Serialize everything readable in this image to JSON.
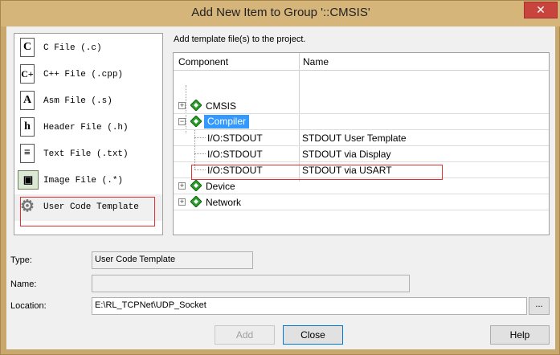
{
  "window": {
    "title": "Add New Item to Group '::CMSIS'",
    "close_glyph": "✕",
    "accent": "#d6b57a"
  },
  "file_types": [
    {
      "label": "C File (.c)",
      "icon": "c-file-icon",
      "glyph": "C"
    },
    {
      "label": "C++ File (.cpp)",
      "icon": "cpp-file-icon",
      "glyph": "C+"
    },
    {
      "label": "Asm File (.s)",
      "icon": "asm-file-icon",
      "glyph": "A"
    },
    {
      "label": "Header File (.h)",
      "icon": "header-file-icon",
      "glyph": "h"
    },
    {
      "label": "Text File (.txt)",
      "icon": "text-file-icon",
      "glyph": "≡"
    },
    {
      "label": "Image File (.*)",
      "icon": "image-file-icon",
      "glyph": "▣"
    },
    {
      "label": "User Code Template",
      "icon": "gear-icon",
      "glyph": "⚙"
    }
  ],
  "hint": "Add template file(s) to the project.",
  "tree": {
    "headers": {
      "component": "Component",
      "name": "Name"
    },
    "rows": [
      {
        "component": "CMSIS",
        "name": "",
        "expander": "+"
      },
      {
        "component": "Compiler",
        "name": "",
        "expander": "−"
      },
      {
        "component": "I/O:STDOUT",
        "name": "STDOUT User Template"
      },
      {
        "component": "I/O:STDOUT",
        "name": "STDOUT via Display"
      },
      {
        "component": "I/O:STDOUT",
        "name": "STDOUT via USART"
      },
      {
        "component": "Device",
        "name": "",
        "expander": "+"
      },
      {
        "component": "Network",
        "name": "",
        "expander": "+"
      }
    ]
  },
  "form": {
    "type_label": "Type:",
    "type_value": "User Code Template",
    "name_label": "Name:",
    "name_value": "",
    "location_label": "Location:",
    "location_value": "E:\\RL_TCPNet\\UDP_Socket",
    "browse_label": "..."
  },
  "buttons": {
    "add": "Add",
    "close": "Close",
    "help": "Help"
  }
}
